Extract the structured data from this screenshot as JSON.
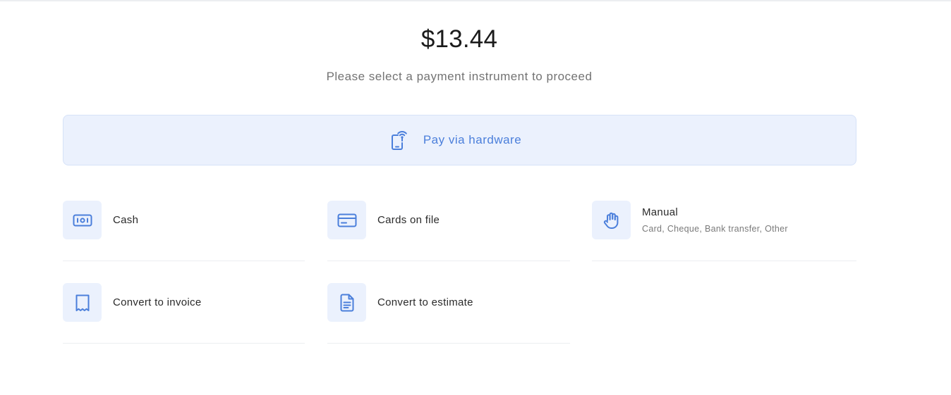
{
  "payment": {
    "amount": "$13.44",
    "subtitle": "Please select a payment instrument to proceed"
  },
  "hardware": {
    "label": "Pay via hardware",
    "icon": "phone-nfc-icon"
  },
  "options": [
    {
      "label": "Cash",
      "sub": "",
      "icon": "cash-icon"
    },
    {
      "label": "Cards on file",
      "sub": "",
      "icon": "credit-card-icon"
    },
    {
      "label": "Manual",
      "sub": "Card, Cheque, Bank transfer, Other",
      "icon": "hand-icon"
    },
    {
      "label": "Convert to invoice",
      "sub": "",
      "icon": "receipt-icon"
    },
    {
      "label": "Convert to estimate",
      "sub": "",
      "icon": "document-icon"
    }
  ],
  "colors": {
    "accent": "#4b7fdb",
    "tile_bg": "#ebf1fd",
    "divider": "#eceef1"
  }
}
